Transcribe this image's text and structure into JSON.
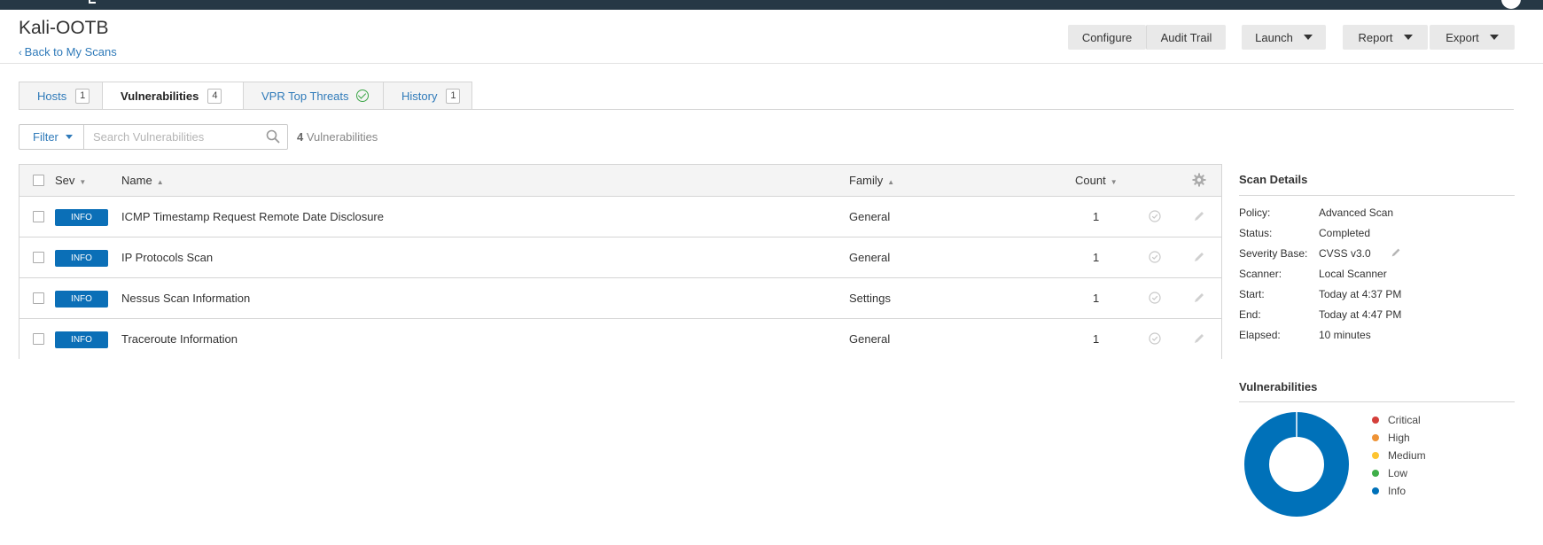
{
  "header": {
    "title": "Kali-OOTB",
    "back_label": "Back to My Scans",
    "buttons": {
      "configure": "Configure",
      "audit_trail": "Audit Trail",
      "launch": "Launch",
      "report": "Report",
      "export": "Export"
    }
  },
  "tabs": [
    {
      "label": "Hosts",
      "count": "1"
    },
    {
      "label": "Vulnerabilities",
      "count": "4",
      "active": true
    },
    {
      "label": "VPR Top Threats",
      "status_icon": "check-circle-icon"
    },
    {
      "label": "History",
      "count": "1"
    }
  ],
  "toolbar": {
    "filter_label": "Filter",
    "search_placeholder": "Search Vulnerabilities",
    "result_count": "4",
    "result_label": "Vulnerabilities"
  },
  "table": {
    "columns": {
      "sev": "Sev",
      "name": "Name",
      "family": "Family",
      "count": "Count"
    },
    "rows": [
      {
        "severity": "INFO",
        "name": "ICMP Timestamp Request Remote Date Disclosure",
        "family": "General",
        "count": "1"
      },
      {
        "severity": "INFO",
        "name": "IP Protocols Scan",
        "family": "General",
        "count": "1"
      },
      {
        "severity": "INFO",
        "name": "Nessus Scan Information",
        "family": "Settings",
        "count": "1"
      },
      {
        "severity": "INFO",
        "name": "Traceroute Information",
        "family": "General",
        "count": "1"
      }
    ]
  },
  "scan_details": {
    "title": "Scan Details",
    "items": [
      {
        "label": "Policy:",
        "value": "Advanced Scan"
      },
      {
        "label": "Status:",
        "value": "Completed"
      },
      {
        "label": "Severity Base:",
        "value": "CVSS v3.0"
      },
      {
        "label": "Scanner:",
        "value": "Local Scanner"
      },
      {
        "label": "Start:",
        "value": "Today at 4:37 PM"
      },
      {
        "label": "End:",
        "value": "Today at 4:47 PM"
      },
      {
        "label": "Elapsed:",
        "value": "10 minutes"
      }
    ]
  },
  "vulnerabilities_panel": {
    "title": "Vulnerabilities",
    "legend": [
      {
        "label": "Critical",
        "color": "#d43f3a"
      },
      {
        "label": "High",
        "color": "#ee9336"
      },
      {
        "label": "Medium",
        "color": "#fdc431"
      },
      {
        "label": "Low",
        "color": "#3fae49"
      },
      {
        "label": "Info",
        "color": "#0071b9"
      }
    ]
  },
  "chart_data": {
    "type": "pie",
    "categories": [
      "Critical",
      "High",
      "Medium",
      "Low",
      "Info"
    ],
    "values": [
      0,
      0,
      0,
      0,
      4
    ],
    "colors": [
      "#d43f3a",
      "#ee9336",
      "#fdc431",
      "#3fae49",
      "#0071b9"
    ],
    "title": "Vulnerabilities",
    "legend": "right"
  },
  "colors": {
    "link": "#2f7ab9",
    "info_badge": "#0b6fb7",
    "topbar": "#263845"
  }
}
